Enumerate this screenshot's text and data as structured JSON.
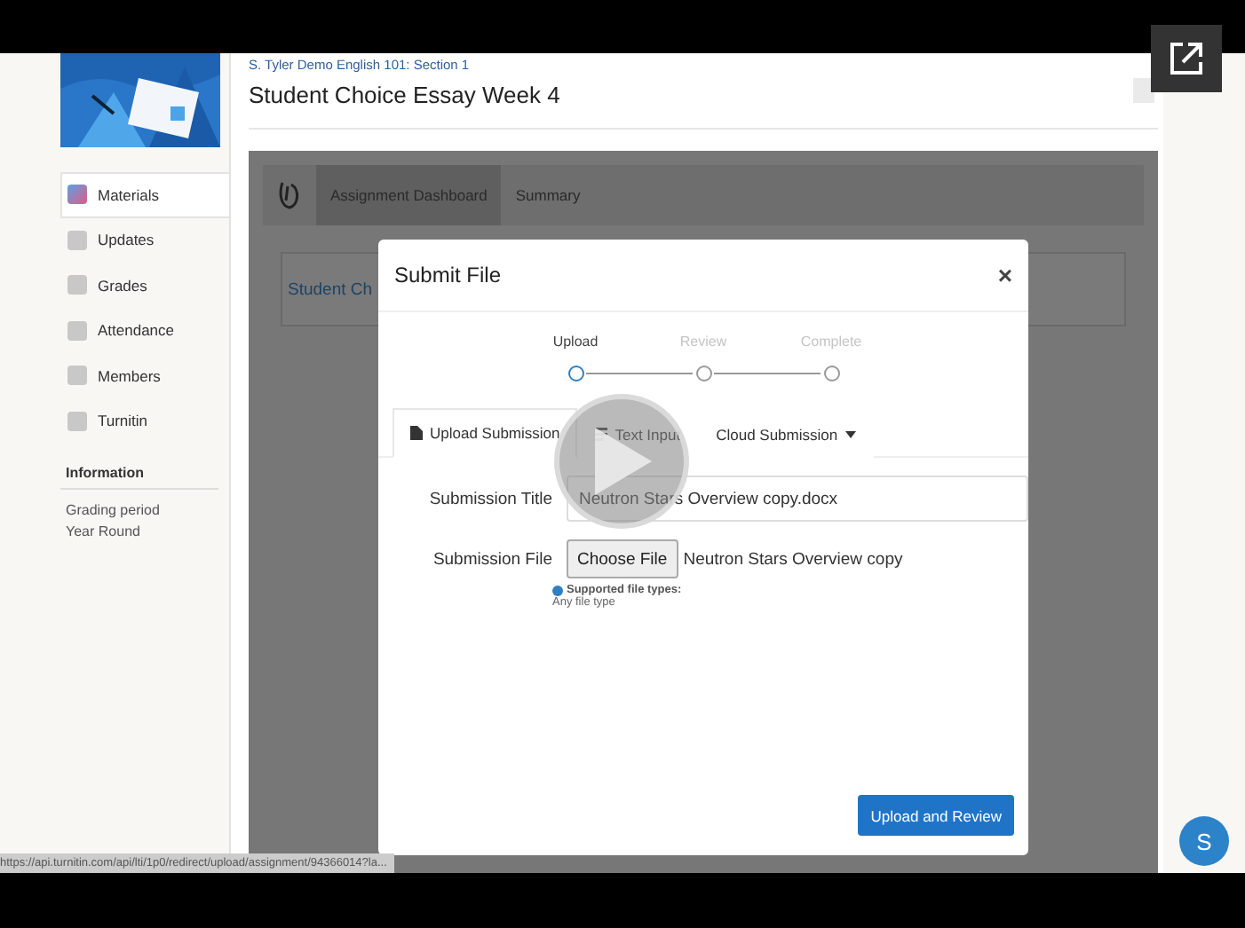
{
  "course": {
    "link": "S. Tyler Demo English 101: Section 1",
    "title": "Student Choice Essay Week 4"
  },
  "sidebar": {
    "items": [
      {
        "label": "Materials",
        "selected": true
      },
      {
        "label": "Updates",
        "selected": false
      },
      {
        "label": "Grades",
        "selected": false
      },
      {
        "label": "Attendance",
        "selected": false
      },
      {
        "label": "Members",
        "selected": false
      },
      {
        "label": "Turnitin",
        "selected": false
      }
    ],
    "info_heading": "Information",
    "info_lines": [
      "Grading period",
      "Year Round"
    ]
  },
  "tool_tabs": [
    {
      "label": "Assignment Dashboard",
      "selected": true
    },
    {
      "label": "Summary",
      "selected": false
    }
  ],
  "card_title": "Student Ch",
  "modal": {
    "title": "Submit File",
    "close": "×",
    "steps": [
      {
        "label": "Upload",
        "selected": true
      },
      {
        "label": "Review",
        "selected": false
      },
      {
        "label": "Complete",
        "selected": false
      }
    ],
    "tabs": [
      {
        "label": "Upload Submission",
        "selected": true,
        "kind": "file"
      },
      {
        "label": "Text Input",
        "selected": false,
        "kind": "text"
      },
      {
        "label": "Cloud Submission",
        "selected": false,
        "kind": "dropdown"
      }
    ],
    "title_label": "Submission Title",
    "title_value": "Neutron Stars Overview copy.docx",
    "file_label": "Submission File",
    "choose_button": "Choose File",
    "file_name": "Neutron Stars Overview copy",
    "supported": "Supported file types:",
    "types": "Any file type",
    "submit": "Upload and Review"
  },
  "status_url": "https://api.turnitin.com/api/lti/1p0/redirect/upload/assignment/94366014?la...",
  "avatar": "S"
}
